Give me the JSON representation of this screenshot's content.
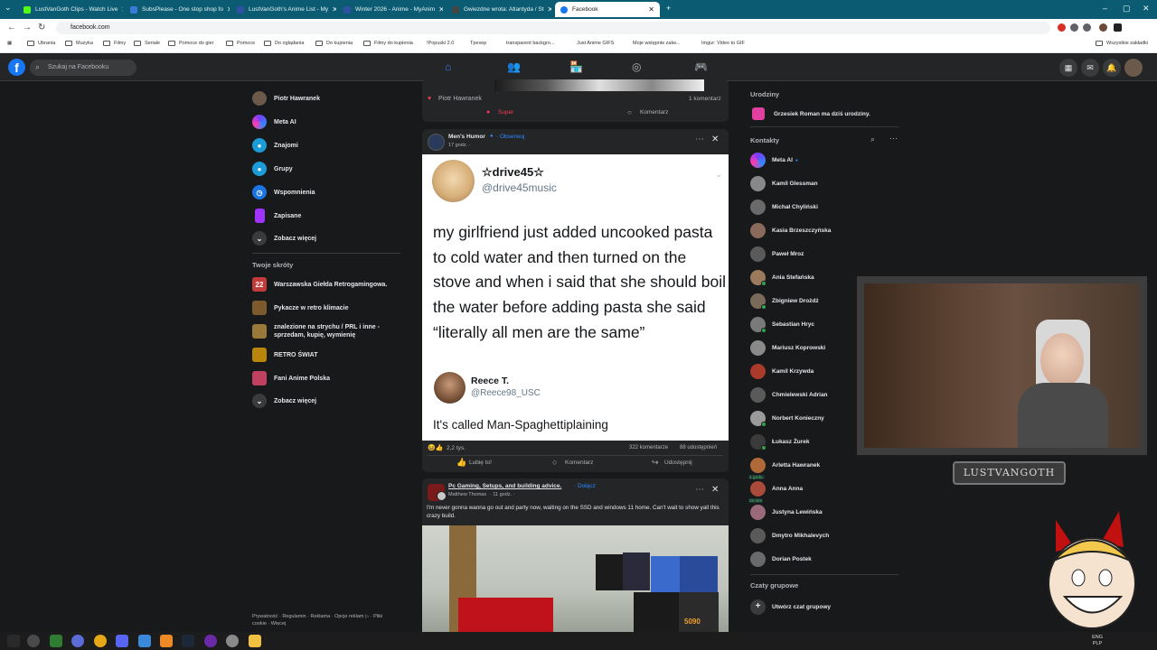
{
  "browser": {
    "tabs": [
      {
        "title": "LustVanGoth Clips - Watch Live",
        "color": "#53fc18"
      },
      {
        "title": "SubsPlease - One stop shop fo",
        "color": "#3a7bd5"
      },
      {
        "title": "LustVanGoth's Anime List - My",
        "color": "#2e51a2"
      },
      {
        "title": "Winter 2026 - Anime - MyAnim",
        "color": "#2e51a2"
      },
      {
        "title": "Gwiezdne wrota: Atlantyda / St",
        "color": "#444444"
      },
      {
        "title": "Facebook",
        "color": "#1877f2"
      }
    ],
    "url": "facebook.com",
    "bookmarks": [
      "Ubrania",
      "Muzyka",
      "Filmy",
      "Seriale",
      "Pomoce do gier",
      "Pomoce",
      "Do oglądania",
      "Do kupienia",
      "Filmy do kupienia",
      "!Popuski 2.0",
      "Tpexep",
      "transparent backgro...",
      "Just Anime GIFS",
      "Moje wstępnie zatw...",
      "Imgur: Video to GIF"
    ],
    "bookmarks_right": "Wszystkie zakładki"
  },
  "header": {
    "logo": "f",
    "search_placeholder": "Szukaj na Facebooku"
  },
  "left_sidebar": {
    "items": [
      {
        "label": "Piotr Hawranek",
        "icon": "avatar",
        "color": "#6b5a4a"
      },
      {
        "label": "Meta AI",
        "icon": "meta-ai-icon",
        "color": "#7a3cff"
      },
      {
        "label": "Znajomi",
        "icon": "friends-icon",
        "color": "#1b9bd8"
      },
      {
        "label": "Grupy",
        "icon": "groups-icon",
        "color": "#1b9bd8"
      },
      {
        "label": "Wspomnienia",
        "icon": "memories-icon",
        "color": "#1b74e4"
      },
      {
        "label": "Zapisane",
        "icon": "saved-icon",
        "color": "#a033ff"
      },
      {
        "label": "Zobacz więcej",
        "icon": "chevron-down-icon",
        "color": "#3a3b3c"
      }
    ],
    "shortcuts_title": "Twoje skróty",
    "shortcuts": [
      {
        "label": "Warszawska Giełda Retrogamingowa.",
        "color": "#c23b3b"
      },
      {
        "label": "Pykacze w retro klimacie",
        "color": "#7d5a2e"
      },
      {
        "label": "znalezione na strychu / PRL i inne - sprzedam, kupię, wymienię",
        "color": "#9a7a3a"
      },
      {
        "label": "RETRO ŚWIAT",
        "color": "#b8860b"
      },
      {
        "label": "Fani Anime Polska",
        "color": "#c04060"
      },
      {
        "label": "Zobacz więcej",
        "color": "#3a3b3c"
      }
    ],
    "footer": "Prywatność · Regulamin · Reklama · Opcje reklam ▷ · Pliki cookie · Więcej"
  },
  "feed": {
    "prev_post": {
      "reactor": "Piotr Hawranek",
      "comments": "1 komentarz",
      "like_label": "Super",
      "comment_label": "Komentarz"
    },
    "post1": {
      "page": "Men's Humor",
      "follow": "· Obserwuj",
      "time": "17 godz. ·",
      "tweet": {
        "name": "☆drive45☆",
        "handle": "@drive45music",
        "text": "my girlfriend just added uncooked pasta to cold water and then turned on the stove and when i said that she should boil the water before adding pasta she said “literally all men are the same”",
        "reply_name": "Reece T.",
        "reply_handle": "@Reece98_USC",
        "reply_text": "It's called Man-Spaghettiplaining"
      },
      "reactions": "2,2 tys.",
      "comments": "322 komentarze",
      "shares": "88 udostępnień",
      "like_btn": "Lubię to!",
      "comment_btn": "Komentarz",
      "share_btn": "Udostępnij"
    },
    "post2": {
      "group": "Pc Gaming, Setups, and building advice.",
      "join": "· Dołącz",
      "author": "Matthew Thomas",
      "time": "· 11 godz. ·",
      "text": "I'm never gonna wanna go out and party now, waiting on the SSD and windows 11 home. Can't wait to show yall this crazy build.",
      "box_label": "5090"
    }
  },
  "right_sidebar": {
    "birthdays_title": "Urodziny",
    "birthday_text": "Grzesiek Roman ma dziś urodziny.",
    "birthday_name": "Grzesiek Roman",
    "contacts_title": "Kontakty",
    "contacts": [
      {
        "name": "Meta AI",
        "color": "#7a3cff",
        "online": false,
        "badge": ""
      },
      {
        "name": "Kamil Glessman",
        "color": "#888888",
        "online": false,
        "badge": ""
      },
      {
        "name": "Michał Chyliński",
        "color": "#6a6a6a",
        "online": false,
        "badge": ""
      },
      {
        "name": "Kasia Brzeszczyńska",
        "color": "#8a6a5a",
        "online": false,
        "badge": ""
      },
      {
        "name": "Paweł Mroz",
        "color": "#5a5a5a",
        "online": false,
        "badge": ""
      },
      {
        "name": "Ania Stefańska",
        "color": "#9a7a5a",
        "online": true,
        "badge": ""
      },
      {
        "name": "Zbigniew Drożdż",
        "color": "#7a6a5a",
        "online": true,
        "badge": ""
      },
      {
        "name": "Sebastian Hryc",
        "color": "#7a7a7a",
        "online": true,
        "badge": ""
      },
      {
        "name": "Mariusz Koprowski",
        "color": "#8a8a8a",
        "online": false,
        "badge": ""
      },
      {
        "name": "Kamil Krzywda",
        "color": "#aa3a2a",
        "online": false,
        "badge": ""
      },
      {
        "name": "Chmielewski Adrian",
        "color": "#5a5a5a",
        "online": false,
        "badge": ""
      },
      {
        "name": "Norbert Konieczny",
        "color": "#9a9a9a",
        "online": true,
        "badge": ""
      },
      {
        "name": "Łukasz Żurek",
        "color": "#3a3a3a",
        "online": true,
        "badge": ""
      },
      {
        "name": "Arletta Hawranek",
        "color": "#b06a3a",
        "online": false,
        "badge": "1 godz."
      },
      {
        "name": "Anna Anna",
        "color": "#aa4a3a",
        "online": false,
        "badge": "25 min"
      },
      {
        "name": "Justyna Lewińska",
        "color": "#9a6a7a",
        "online": false,
        "badge": ""
      },
      {
        "name": "Dmytro Mikhalevych",
        "color": "#5a5a5a",
        "online": false,
        "badge": ""
      },
      {
        "name": "Dorian Postek",
        "color": "#6a6a6a",
        "online": false,
        "badge": ""
      }
    ],
    "group_chats_title": "Czaty grupowe",
    "create_group": "Utwórz czat grupowy"
  },
  "overlay": {
    "name_plate": "LUSTVANGOTH"
  },
  "taskbar": {
    "lang": "ENG",
    "lang2": "PLP"
  }
}
